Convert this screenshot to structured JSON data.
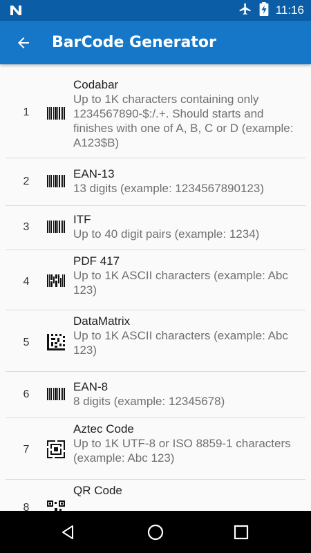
{
  "status_bar": {
    "time": "11:16"
  },
  "app_bar": {
    "title": "BarCode Generator"
  },
  "items": [
    {
      "number": "1",
      "title": "Codabar",
      "description": "Up to 1K characters containing only 1234567890-$:/.+. Should starts and finishes with one of A, B, C or D (example: A123$B)",
      "icon": "barcode-linear-icon"
    },
    {
      "number": "2",
      "title": "EAN-13",
      "description": "13 digits (example: 1234567890123)",
      "icon": "barcode-linear-icon"
    },
    {
      "number": "3",
      "title": "ITF",
      "description": "Up to 40 digit pairs (example: 1234)",
      "icon": "barcode-linear-icon"
    },
    {
      "number": "4",
      "title": "PDF 417",
      "description": "Up to 1K ASCII characters (example: Abc 123)",
      "icon": "pdf417-icon"
    },
    {
      "number": "5",
      "title": "DataMatrix",
      "description": "Up to 1K ASCII characters (example: Abc 123)",
      "icon": "datamatrix-icon"
    },
    {
      "number": "6",
      "title": "EAN-8",
      "description": "8 digits (example: 12345678)",
      "icon": "barcode-linear-icon"
    },
    {
      "number": "7",
      "title": "Aztec Code",
      "description": "Up to 1K UTF-8 or ISO 8859-1 characters (example: Abc 123)",
      "icon": "aztec-icon"
    },
    {
      "number": "8",
      "title": "QR Code",
      "description": "",
      "icon": "qr-code-icon"
    }
  ],
  "colors": {
    "status_bar": "#0b5ea6",
    "app_bar": "#1677c8",
    "nav_bar": "#000000"
  }
}
